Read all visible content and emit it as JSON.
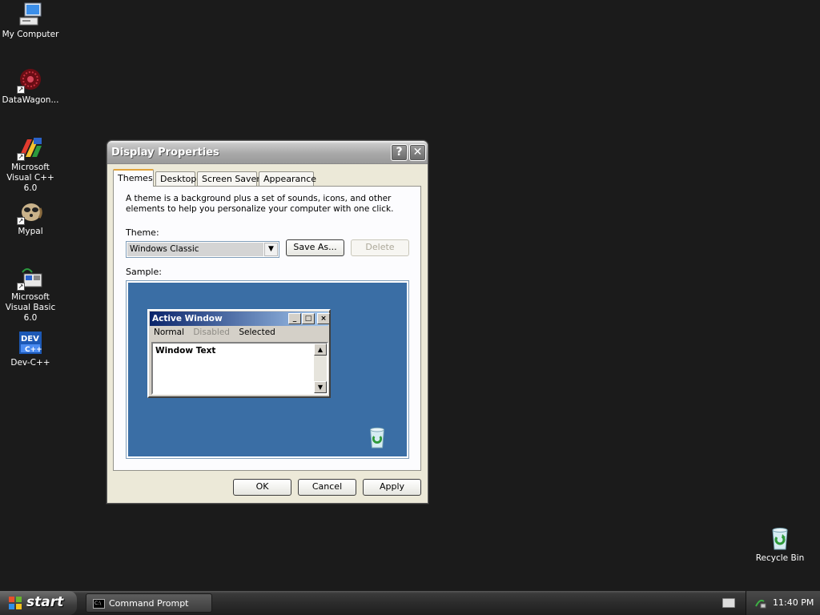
{
  "desktop": {
    "icons": [
      {
        "label": "My Computer",
        "icon": "my-computer-icon"
      },
      {
        "label": "DataWagon...",
        "icon": "datawagon-icon"
      },
      {
        "label": "Microsoft Visual C++ 6.0",
        "icon": "visual-cpp-icon"
      },
      {
        "label": "Mypal",
        "icon": "mypal-icon"
      },
      {
        "label": "Microsoft Visual Basic 6.0",
        "icon": "visual-basic-icon"
      },
      {
        "label": "Dev-C++",
        "icon": "dev-cpp-icon"
      },
      {
        "label": "Recycle Bin",
        "icon": "recycle-bin-icon"
      }
    ]
  },
  "dialog": {
    "title": "Display Properties",
    "help_glyph": "?",
    "close_glyph": "✕",
    "tabs": [
      {
        "label": "Themes",
        "active": true
      },
      {
        "label": "Desktop",
        "active": false
      },
      {
        "label": "Screen Saver",
        "active": false
      },
      {
        "label": "Appearance",
        "active": false
      }
    ],
    "description": "A theme is a background plus a set of sounds, icons, and other elements to help you personalize your computer with one click.",
    "theme_label": "Theme:",
    "theme_value": "Windows Classic",
    "save_as_label": "Save As...",
    "delete_label": "Delete",
    "sample_label": "Sample:",
    "sample": {
      "window_title": "Active Window",
      "menu_normal": "Normal",
      "menu_disabled": "Disabled",
      "menu_selected": "Selected",
      "window_text": "Window Text",
      "background_color": "#3a6ea5"
    },
    "ok_label": "OK",
    "cancel_label": "Cancel",
    "apply_label": "Apply"
  },
  "taskbar": {
    "start_label": "start",
    "task_buttons": [
      {
        "label": "Command Prompt",
        "icon": "command-prompt-icon"
      }
    ],
    "clock": "11:40 PM"
  }
}
